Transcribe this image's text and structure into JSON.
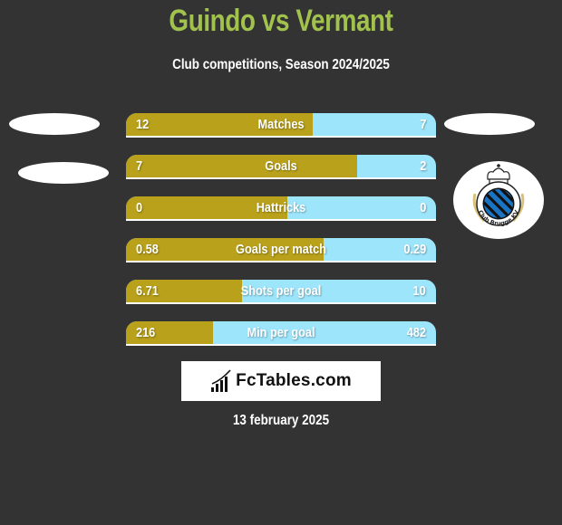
{
  "header": {
    "title": "Guindo vs Vermant",
    "subtitle": "Club competitions, Season 2024/2025"
  },
  "colors": {
    "background": "#333333",
    "title": "#a2c24e",
    "left_player": "#b9a11b",
    "right_player": "#9de5fb"
  },
  "right_team": {
    "name": "Club Brugge KV",
    "badge_icon": "club-brugge-badge"
  },
  "stats": [
    {
      "label": "Matches",
      "left": "12",
      "right": "7",
      "left_share": 0.602
    },
    {
      "label": "Goals",
      "left": "7",
      "right": "2",
      "left_share": 0.746
    },
    {
      "label": "Hattricks",
      "left": "0",
      "right": "0",
      "left_share": 0.52
    },
    {
      "label": "Goals per match",
      "left": "0.58",
      "right": "0.29",
      "left_share": 0.637
    },
    {
      "label": "Shots per goal",
      "left": "6.71",
      "right": "10",
      "left_share": 0.374
    },
    {
      "label": "Min per goal",
      "left": "216",
      "right": "482",
      "left_share": 0.281
    }
  ],
  "footer": {
    "brand": "FcTables.com",
    "brand_icon": "bar-chart-icon",
    "date": "13 february 2025"
  }
}
